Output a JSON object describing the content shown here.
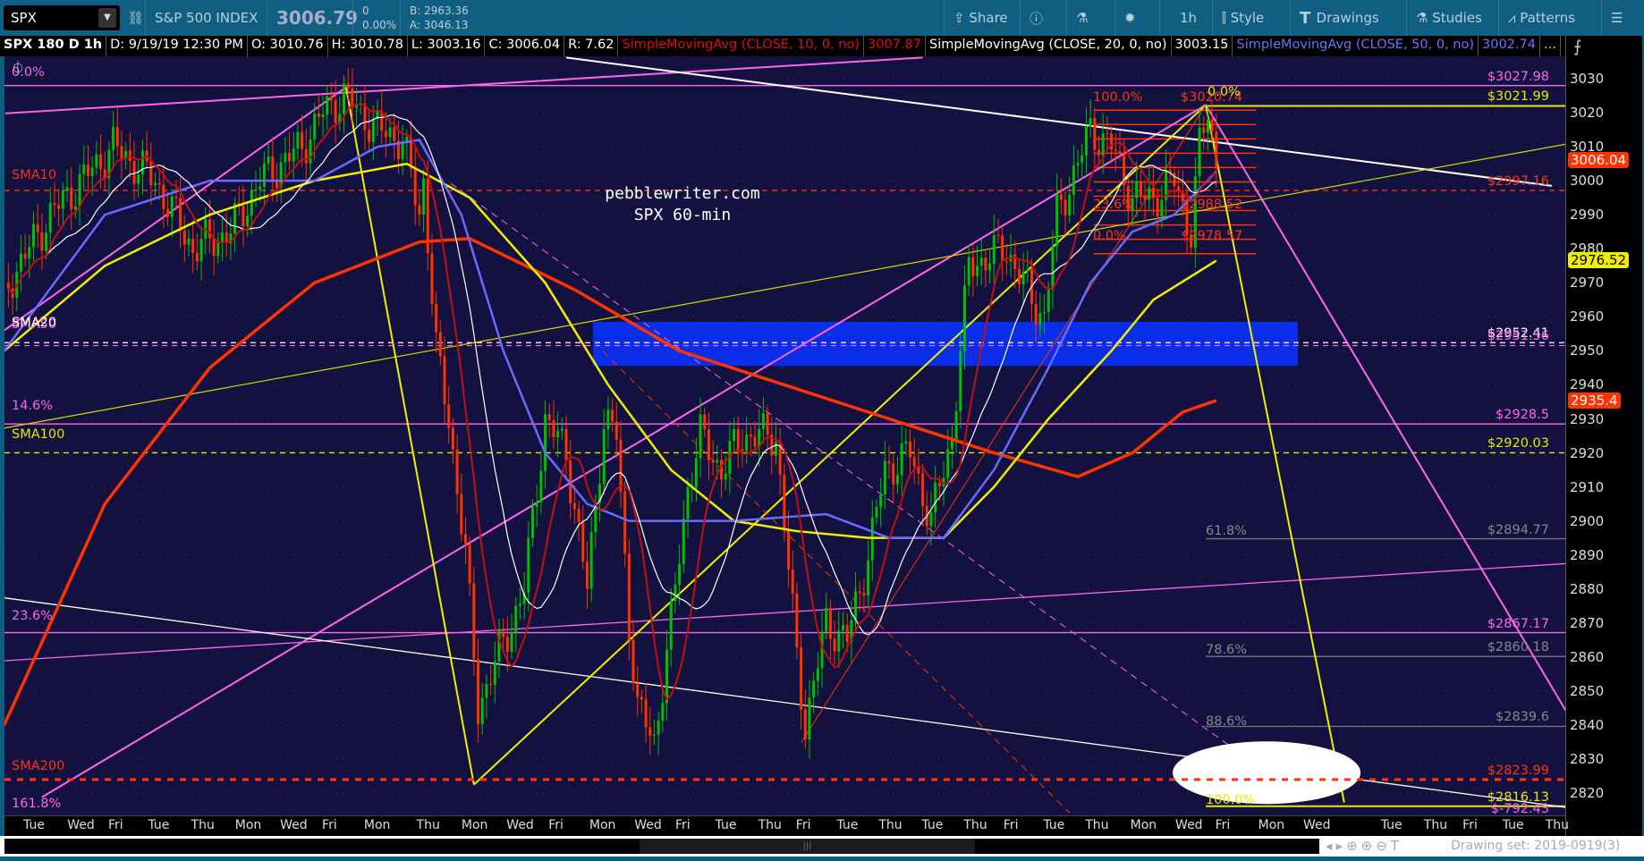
{
  "toolbar": {
    "symbol": "SPX",
    "name": "S&P 500 INDEX",
    "last": "3006.79",
    "change": "0",
    "change_pct": "0.00%",
    "bid": "B: 2963.36",
    "ask": "A: 3046.13",
    "buttons": {
      "share": "Share",
      "interval": "1h",
      "style": "Style",
      "drawings": "Drawings",
      "studies": "Studies",
      "patterns": "Patterns"
    }
  },
  "infobar": {
    "title": "SPX 180 D 1h",
    "date": "D: 9/19/19 12:30 PM",
    "open": "O: 3010.76",
    "high": "H: 3010.78",
    "low": "L: 3003.16",
    "close": "C: 3006.04",
    "range": "R: 7.62",
    "sma10": "SimpleMovingAvg (CLOSE, 10, 0, no)",
    "sma10_val": "3007.87",
    "sma20": "SimpleMovingAvg (CLOSE, 20, 0, no)",
    "sma20_val": "3003.15",
    "sma50": "SimpleMovingAvg (CLOSE, 50, 0, no)",
    "sma50_val": "3002.74",
    "more": "..."
  },
  "watermark": {
    "line1": "pebblewriter.com",
    "line2": "SPX 60-min"
  },
  "left_labels": {
    "fib0": "0.0%",
    "sma10": "SMA10",
    "sma20": "SMA20",
    "sma50": "SMA50",
    "fib146": "14.6%",
    "sma100": "SMA100",
    "fib236": "23.6%",
    "sma200": "SMA200",
    "fib1618": "161.8%"
  },
  "levels": [
    {
      "price": 3027.98,
      "label": "$3027.98",
      "color": "#ff66ee",
      "style": "solid"
    },
    {
      "price": 3021.99,
      "label": "$3021.99",
      "color": "#e8e800",
      "style": "solid",
      "from": 287.5
    },
    {
      "price": 2997.16,
      "label": "$2997.16",
      "color": "#ff3311",
      "style": "dash"
    },
    {
      "price": 2952.41,
      "label": "$2952.41",
      "color": "#ffffff",
      "style": "dash"
    },
    {
      "price": 2951.56,
      "label": "$2951.56",
      "color": "#ff66ee",
      "style": "dash"
    },
    {
      "price": 2928.5,
      "label": "$2928.5",
      "color": "#ff66ee",
      "style": "solid"
    },
    {
      "price": 2920.03,
      "label": "$2920.03",
      "color": "#e8e800",
      "style": "dash"
    },
    {
      "price": 2894.77,
      "label": "$2894.77",
      "color": "#777777",
      "style": "solid",
      "from": 287.5
    },
    {
      "price": 2867.17,
      "label": "$2867.17",
      "color": "#ff66ee",
      "style": "solid"
    },
    {
      "price": 2860.18,
      "label": "$2860.18",
      "color": "#777777",
      "style": "solid",
      "from": 287.5
    },
    {
      "price": 2839.6,
      "label": "$2839.6",
      "color": "#777777",
      "style": "solid",
      "from": 287.5
    },
    {
      "price": 2823.99,
      "label": "$2823.99",
      "color": "#ff3311",
      "style": "bigdash"
    },
    {
      "price": 2816.13,
      "label": "$2816.13",
      "color": "#e8e800",
      "style": "solid",
      "from": 287.5
    },
    {
      "price": 2815.9,
      "label": "$-792.43",
      "color": "#ff66ee",
      "style": "none"
    }
  ],
  "fib_labels": [
    {
      "price": 2897,
      "text": "61.8%"
    },
    {
      "price": 2862,
      "text": "78.6%"
    },
    {
      "price": 2841,
      "text": "88.6%"
    },
    {
      "price": 2818,
      "text": "100.0%",
      "color": "#e8e800"
    }
  ],
  "fib_box": {
    "top": 3020.74,
    "bottom": 2978.57,
    "labels": {
      "p100": "100.0%",
      "top_price": "$3020.74",
      "p236": "23.6%",
      "mid_price": "$2988.52",
      "p0": "0.0%",
      "bottom_price": "$2978.57",
      "peak": "0.0%"
    }
  },
  "zone": {
    "top": 2958.5,
    "bottom": 2945.6
  },
  "axis": {
    "ticks": [
      3030,
      3020,
      3010,
      3000,
      2990,
      2980,
      2970,
      2960,
      2950,
      2940,
      2930,
      2920,
      2910,
      2900,
      2890,
      2880,
      2870,
      2860,
      2850,
      2840,
      2830,
      2820
    ],
    "badges": [
      {
        "price": 3006.04,
        "text": "3006.04",
        "bg": "#ff3300",
        "fg": "#fff"
      },
      {
        "price": 2976.52,
        "text": "2976.52",
        "bg": "#eeee00",
        "fg": "#000"
      },
      {
        "price": 2935.4,
        "text": "2935.4",
        "bg": "#ff3300",
        "fg": "#fff"
      }
    ]
  },
  "time_labels": [
    "Tue",
    "Wed",
    "Fri",
    "Tue",
    "Thu",
    "Mon",
    "Wed",
    "Fri",
    "Mon",
    "Thu",
    "Mon",
    "Wed",
    "Fri",
    "Mon",
    "Wed",
    "Fri",
    "Tue",
    "Thu",
    "Fri",
    "Tue",
    "Thu",
    "Tue",
    "Thu",
    "Fri",
    "Tue",
    "Thu",
    "Mon",
    "Wed",
    "Fri",
    "Mon",
    "Wed",
    "Tue",
    "Thu",
    "Fri",
    "Tue",
    "Thu"
  ],
  "footer": {
    "drawing_set": "Drawing set: 2019-0919(3)"
  },
  "chart_data": {
    "type": "candlestick",
    "title": "SPX 180 D 1h",
    "ylim": [
      2815,
      3032
    ],
    "price_path": [
      [
        2,
        2970
      ],
      [
        12,
        2990
      ],
      [
        27,
        3010
      ],
      [
        37,
        3000
      ],
      [
        46,
        2980
      ],
      [
        55,
        2985
      ],
      [
        62,
        3000
      ],
      [
        72,
        3010
      ],
      [
        77,
        3020
      ],
      [
        82,
        3025
      ],
      [
        90,
        3015
      ],
      [
        96,
        3012
      ],
      [
        100,
        2990
      ],
      [
        101,
        3000
      ],
      [
        104,
        2950
      ],
      [
        107,
        2930
      ],
      [
        111,
        2890
      ],
      [
        114,
        2845
      ],
      [
        117,
        2855
      ],
      [
        122,
        2870
      ],
      [
        125,
        2880
      ],
      [
        127,
        2900
      ],
      [
        130,
        2930
      ],
      [
        135,
        2920
      ],
      [
        140,
        2880
      ],
      [
        144,
        2930
      ],
      [
        147,
        2925
      ],
      [
        150,
        2870
      ],
      [
        152,
        2845
      ],
      [
        156,
        2835
      ],
      [
        160,
        2870
      ],
      [
        164,
        2910
      ],
      [
        167,
        2925
      ],
      [
        172,
        2915
      ],
      [
        177,
        2925
      ],
      [
        185,
        2925
      ],
      [
        190,
        2860
      ],
      [
        192,
        2840
      ],
      [
        197,
        2870
      ],
      [
        202,
        2865
      ],
      [
        207,
        2890
      ],
      [
        211,
        2915
      ],
      [
        217,
        2920
      ],
      [
        222,
        2900
      ],
      [
        227,
        2925
      ],
      [
        231,
        2975
      ],
      [
        240,
        2980
      ],
      [
        246,
        2965
      ],
      [
        249,
        2960
      ],
      [
        252,
        2990
      ],
      [
        257,
        3005
      ],
      [
        260,
        3015
      ],
      [
        265,
        3010
      ],
      [
        270,
        2995
      ],
      [
        275,
        2995
      ],
      [
        280,
        3000
      ],
      [
        284,
        2985
      ],
      [
        286,
        3010
      ],
      [
        288,
        3020
      ],
      [
        290,
        3006
      ]
    ],
    "sma200": [
      [
        1,
        2840
      ],
      [
        25,
        2905
      ],
      [
        50,
        2945
      ],
      [
        75,
        2970
      ],
      [
        100,
        2982
      ],
      [
        112,
        2983
      ],
      [
        137,
        2968
      ],
      [
        162,
        2950
      ],
      [
        187,
        2940
      ],
      [
        212,
        2930
      ],
      [
        237,
        2920
      ],
      [
        257,
        2913
      ],
      [
        270,
        2920
      ],
      [
        282,
        2932
      ],
      [
        290,
        2935.4
      ]
    ],
    "sma100": [
      [
        1,
        2950
      ],
      [
        25,
        2975
      ],
      [
        50,
        2990
      ],
      [
        75,
        3000
      ],
      [
        97,
        3005
      ],
      [
        112,
        2995
      ],
      [
        130,
        2970
      ],
      [
        145,
        2940
      ],
      [
        160,
        2915
      ],
      [
        175,
        2900
      ],
      [
        190,
        2897
      ],
      [
        207,
        2895
      ],
      [
        225,
        2895
      ],
      [
        237,
        2910
      ],
      [
        250,
        2930
      ],
      [
        265,
        2950
      ],
      [
        275,
        2965
      ],
      [
        290,
        2976.5
      ]
    ],
    "sma50": [
      [
        1,
        2950
      ],
      [
        25,
        2990
      ],
      [
        50,
        3000
      ],
      [
        75,
        3000
      ],
      [
        90,
        3010
      ],
      [
        100,
        3012
      ],
      [
        110,
        2990
      ],
      [
        120,
        2950
      ],
      [
        130,
        2920
      ],
      [
        140,
        2905
      ],
      [
        150,
        2900
      ],
      [
        175,
        2900
      ],
      [
        197,
        2902
      ],
      [
        212,
        2895
      ],
      [
        225,
        2895
      ],
      [
        237,
        2915
      ],
      [
        250,
        2945
      ],
      [
        260,
        2970
      ],
      [
        270,
        2985
      ],
      [
        280,
        2990
      ],
      [
        290,
        3002.7
      ]
    ]
  }
}
